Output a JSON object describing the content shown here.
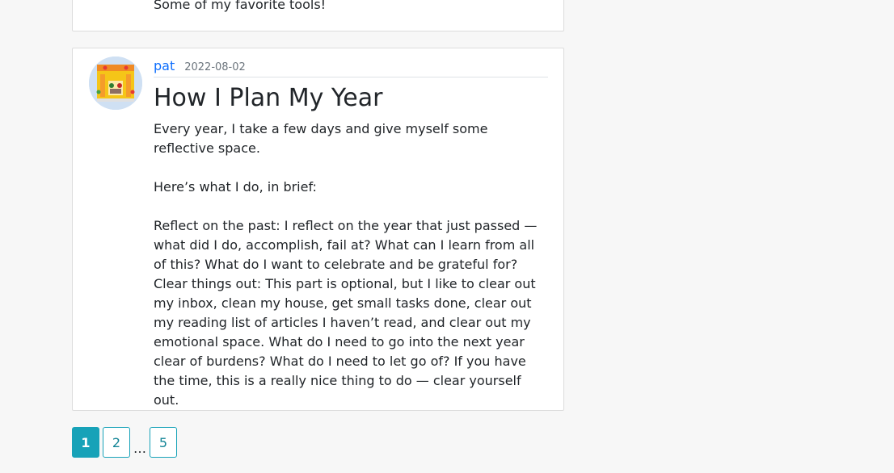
{
  "previous_post": {
    "excerpt": "Some of my favorite tools!"
  },
  "post": {
    "author": "pat",
    "date": "2022-08-02",
    "title": "How I Plan My Year",
    "paragraphs": [
      "Every year, I take a few days and give myself some reflective space.",
      "Here’s what I do, in brief:",
      "Reflect on the past: I reflect on the year that just passed — what did I do, accomplish, fail at? What can I learn from all of this? What do I want to celebrate and be grateful for?",
      "Clear things out: This part is optional, but I like to clear out my inbox, clean my house, get small tasks done, clear out my reading list of articles I haven’t read, and clear out my emotional space. What do I need to go into the next year clear of burdens? What do I need to let go of? If you have the time, this is a really nice thing to do — clear yourself out."
    ],
    "avatar_icon": "illustrated-avatar"
  },
  "pagination": {
    "pages": [
      "1",
      "2",
      "5"
    ],
    "current": "1",
    "ellipsis": "…"
  },
  "colors": {
    "accent": "#17a2b8",
    "link": "#0d6efd",
    "background": "#f7f7f7"
  }
}
